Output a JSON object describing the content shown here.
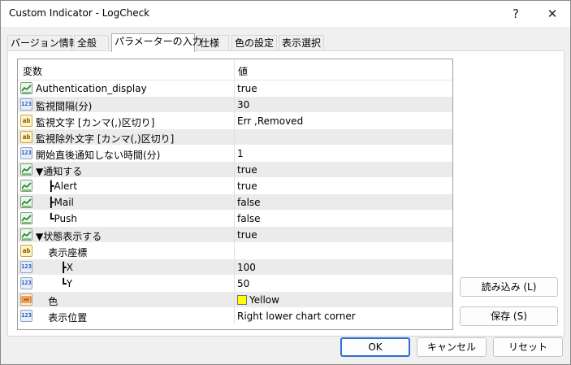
{
  "window": {
    "title": "Custom Indicator - LogCheck",
    "help_glyph": "?",
    "close_glyph": "✕"
  },
  "tabs": [
    {
      "label": "バージョン情報"
    },
    {
      "label": "全般"
    },
    {
      "label": "パラメーターの入力"
    },
    {
      "label": "仕様"
    },
    {
      "label": "色の設定"
    },
    {
      "label": "表示選択"
    }
  ],
  "grid": {
    "header": {
      "variable": "変数",
      "value": "値"
    },
    "rows": [
      {
        "icon": "bool-icon",
        "name": "Authentication_display",
        "value": "true"
      },
      {
        "icon": "number-icon",
        "name": "監視間隔(分)",
        "value": "30"
      },
      {
        "icon": "string-icon",
        "name": "監視文字 [カンマ(,)区切り]",
        "value": "Err ,Removed"
      },
      {
        "icon": "string-icon",
        "name": "監視除外文字 [カンマ(,)区切り]",
        "value": ""
      },
      {
        "icon": "number-icon",
        "name": "開始直後通知しない時間(分)",
        "value": "1"
      },
      {
        "icon": "bool-icon",
        "name": "▼通知する",
        "value": "true"
      },
      {
        "icon": "bool-icon",
        "name": "    ┣Alert",
        "value": "true"
      },
      {
        "icon": "bool-icon",
        "name": "    ┣Mail",
        "value": "false"
      },
      {
        "icon": "bool-icon",
        "name": "    ┗Push",
        "value": "false"
      },
      {
        "icon": "bool-icon",
        "name": "▼状態表示する",
        "value": "true"
      },
      {
        "icon": "string-icon",
        "name": "    表示座標",
        "value": ""
      },
      {
        "icon": "number-icon",
        "name": "        ┣X",
        "value": "100"
      },
      {
        "icon": "number-icon",
        "name": "        ┗Y",
        "value": "50"
      },
      {
        "icon": "color-icon",
        "name": "    色",
        "value": "Yellow",
        "swatch": "#ffff00"
      },
      {
        "icon": "number-icon",
        "name": "    表示位置",
        "value": "Right lower chart corner"
      }
    ]
  },
  "side_buttons": {
    "load": "読み込み (L)",
    "save": "保存 (S)"
  },
  "footer": {
    "ok": "OK",
    "cancel": "キャンセル",
    "reset": "リセット"
  },
  "icon_text": {
    "number": "123",
    "string": "ab"
  }
}
